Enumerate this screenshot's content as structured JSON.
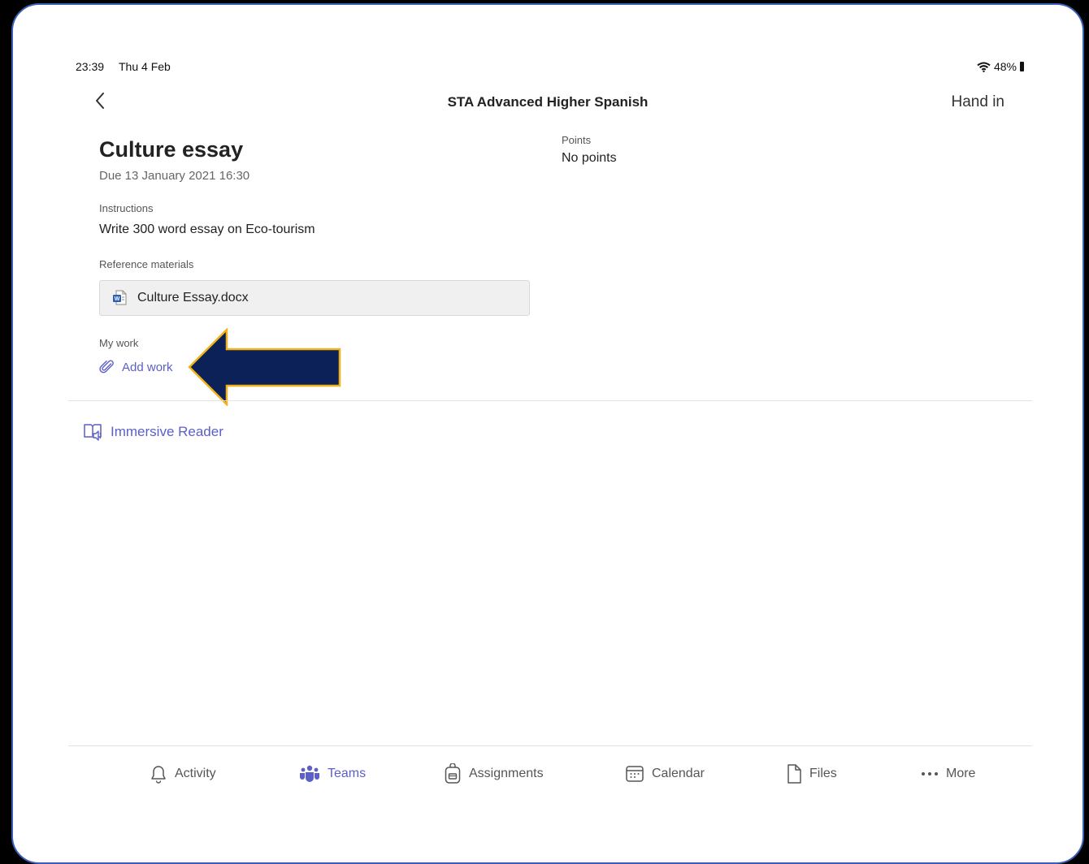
{
  "status_bar": {
    "time": "23:39",
    "date": "Thu 4 Feb",
    "battery": "48%"
  },
  "header": {
    "title": "STA Advanced Higher Spanish",
    "hand_in": "Hand in"
  },
  "assignment": {
    "title": "Culture essay",
    "due": "Due 13 January 2021 16:30",
    "instructions_label": "Instructions",
    "instructions_text": "Write 300 word essay on Eco-tourism",
    "reference_label": "Reference materials",
    "reference_file": "Culture Essay.docx",
    "my_work_label": "My work",
    "add_work": "Add work",
    "points_label": "Points",
    "points_value": "No points"
  },
  "immersive_reader": "Immersive Reader",
  "tabs": [
    {
      "label": "Activity",
      "icon": "bell-icon"
    },
    {
      "label": "Teams",
      "icon": "teams-icon"
    },
    {
      "label": "Assignments",
      "icon": "backpack-icon"
    },
    {
      "label": "Calendar",
      "icon": "calendar-icon"
    },
    {
      "label": "Files",
      "icon": "file-icon"
    },
    {
      "label": "More",
      "icon": "more-icon"
    }
  ],
  "colors": {
    "accent": "#5b5fc7",
    "arrow_fill": "#0c2158",
    "arrow_stroke": "#f2b21b",
    "frame_border": "#3a5fb8"
  }
}
